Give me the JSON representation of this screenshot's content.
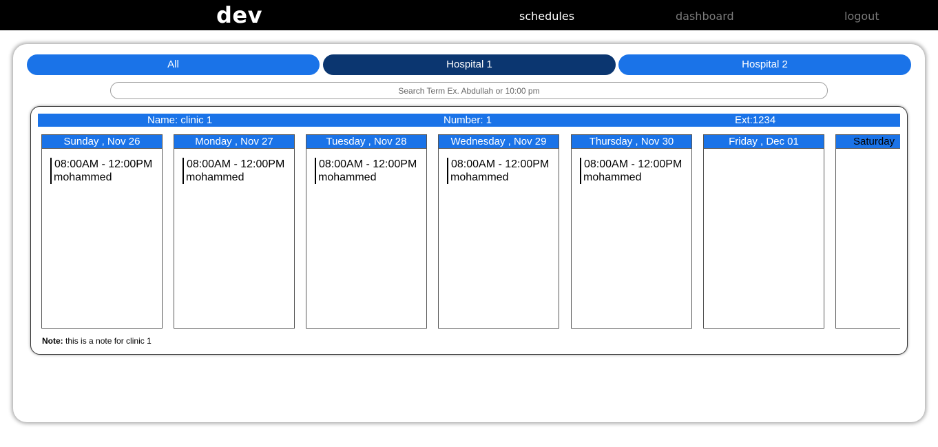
{
  "header": {
    "brand": "dev",
    "nav": {
      "schedules": "schedules",
      "dashboard": "dashboard",
      "logout": "logout"
    }
  },
  "tabs": [
    {
      "label": "All",
      "active": false
    },
    {
      "label": "Hospital 1",
      "active": true
    },
    {
      "label": "Hospital 2",
      "active": false
    }
  ],
  "search": {
    "placeholder": "Search Term Ex. Abdullah or 10:00 pm",
    "value": ""
  },
  "clinic": {
    "name": "Name: clinic 1",
    "number": "Number: 1",
    "ext": "Ext:1234",
    "days": [
      {
        "label": "Sunday , Nov 26",
        "slots": [
          {
            "time": "08:00AM - 12:00PM",
            "person": "mohammed"
          }
        ]
      },
      {
        "label": "Monday , Nov 27",
        "slots": [
          {
            "time": "08:00AM - 12:00PM",
            "person": "mohammed"
          }
        ]
      },
      {
        "label": "Tuesday , Nov 28",
        "slots": [
          {
            "time": "08:00AM - 12:00PM",
            "person": "mohammed"
          }
        ]
      },
      {
        "label": "Wednesday , Nov 29",
        "slots": [
          {
            "time": "08:00AM - 12:00PM",
            "person": "mohammed"
          }
        ]
      },
      {
        "label": "Thursday , Nov 30",
        "slots": [
          {
            "time": "08:00AM - 12:00PM",
            "person": "mohammed"
          }
        ]
      },
      {
        "label": "Friday , Dec 01",
        "slots": []
      },
      {
        "label": "Saturday",
        "slots": []
      }
    ],
    "note_label": "Note:",
    "note_text": "this is a note for clinic 1"
  },
  "colors": {
    "topbar": "#000000",
    "tab": "#1a73e8",
    "tab_active": "#0b3670",
    "day_header": "#1a73e8"
  }
}
